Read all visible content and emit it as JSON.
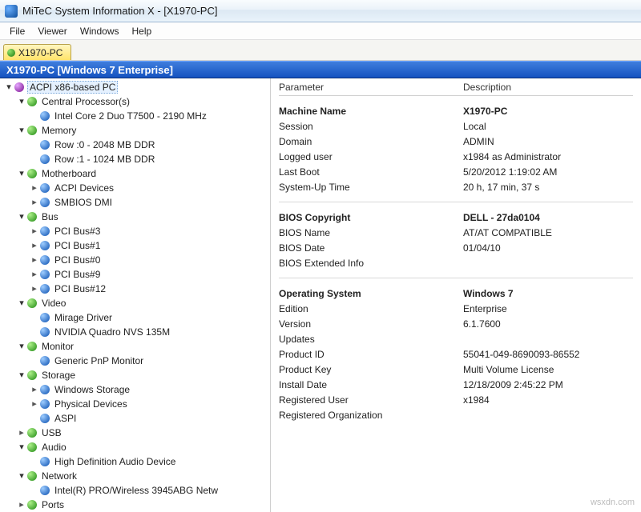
{
  "window": {
    "title": "MiTeC System Information X - [X1970-PC]"
  },
  "menu": {
    "file": "File",
    "viewer": "Viewer",
    "windows": "Windows",
    "help": "Help"
  },
  "tab": {
    "label": "X1970-PC"
  },
  "header": {
    "text": "X1970-PC [Windows 7 Enterprise]"
  },
  "tree": {
    "root": "ACPI x86-based PC",
    "cpu": {
      "label": "Central Processor(s)",
      "item0": "Intel Core 2 Duo T7500 - 2190 MHz"
    },
    "memory": {
      "label": "Memory",
      "row0": "Row :0 - 2048 MB DDR",
      "row1": "Row :1 - 1024 MB DDR"
    },
    "mobo": {
      "label": "Motherboard",
      "acpi": "ACPI Devices",
      "smbios": "SMBIOS DMI"
    },
    "bus": {
      "label": "Bus",
      "b3": "PCI Bus#3",
      "b1": "PCI Bus#1",
      "b0": "PCI Bus#0",
      "b9": "PCI Bus#9",
      "b12": "PCI Bus#12"
    },
    "video": {
      "label": "Video",
      "v0": "Mirage Driver",
      "v1": "NVIDIA Quadro NVS 135M"
    },
    "monitor": {
      "label": "Monitor",
      "m0": "Generic PnP Monitor"
    },
    "storage": {
      "label": "Storage",
      "s0": "Windows Storage",
      "s1": "Physical Devices",
      "s2": "ASPI"
    },
    "usb": {
      "label": "USB"
    },
    "audio": {
      "label": "Audio",
      "a0": "High Definition Audio Device"
    },
    "network": {
      "label": "Network",
      "n0": "Intel(R) PRO/Wireless 3945ABG Netw"
    },
    "ports": {
      "label": "Ports"
    }
  },
  "columns": {
    "param": "Parameter",
    "desc": "Description"
  },
  "g1": {
    "machine_name_l": "Machine Name",
    "machine_name_v": "X1970-PC",
    "session_l": "Session",
    "session_v": "Local",
    "domain_l": "Domain",
    "domain_v": "ADMIN",
    "logged_l": "Logged user",
    "logged_v": "x1984 as Administrator",
    "lastboot_l": "Last Boot",
    "lastboot_v": "5/20/2012 1:19:02 AM",
    "uptime_l": "System-Up Time",
    "uptime_v": "20 h, 17 min, 37 s"
  },
  "g2": {
    "bios_cr_l": "BIOS Copyright",
    "bios_cr_v": "DELL   - 27da0104",
    "bios_name_l": "BIOS Name",
    "bios_name_v": "AT/AT COMPATIBLE",
    "bios_date_l": "BIOS Date",
    "bios_date_v": "01/04/10",
    "bios_ext_l": "BIOS Extended Info",
    "bios_ext_v": ""
  },
  "g3": {
    "os_l": "Operating System",
    "os_v": "Windows 7",
    "ed_l": "Edition",
    "ed_v": "Enterprise",
    "ver_l": "Version",
    "ver_v": "6.1.7600",
    "upd_l": "Updates",
    "upd_v": "",
    "pid_l": "Product ID",
    "pid_v": "55041-049-8690093-86552",
    "pkey_l": "Product Key",
    "pkey_v": "Multi Volume License",
    "inst_l": "Install Date",
    "inst_v": "12/18/2009 2:45:22 PM",
    "ruser_l": "Registered User",
    "ruser_v": "x1984",
    "rorg_l": "Registered Organization",
    "rorg_v": ""
  },
  "watermark": "wsxdn.com"
}
